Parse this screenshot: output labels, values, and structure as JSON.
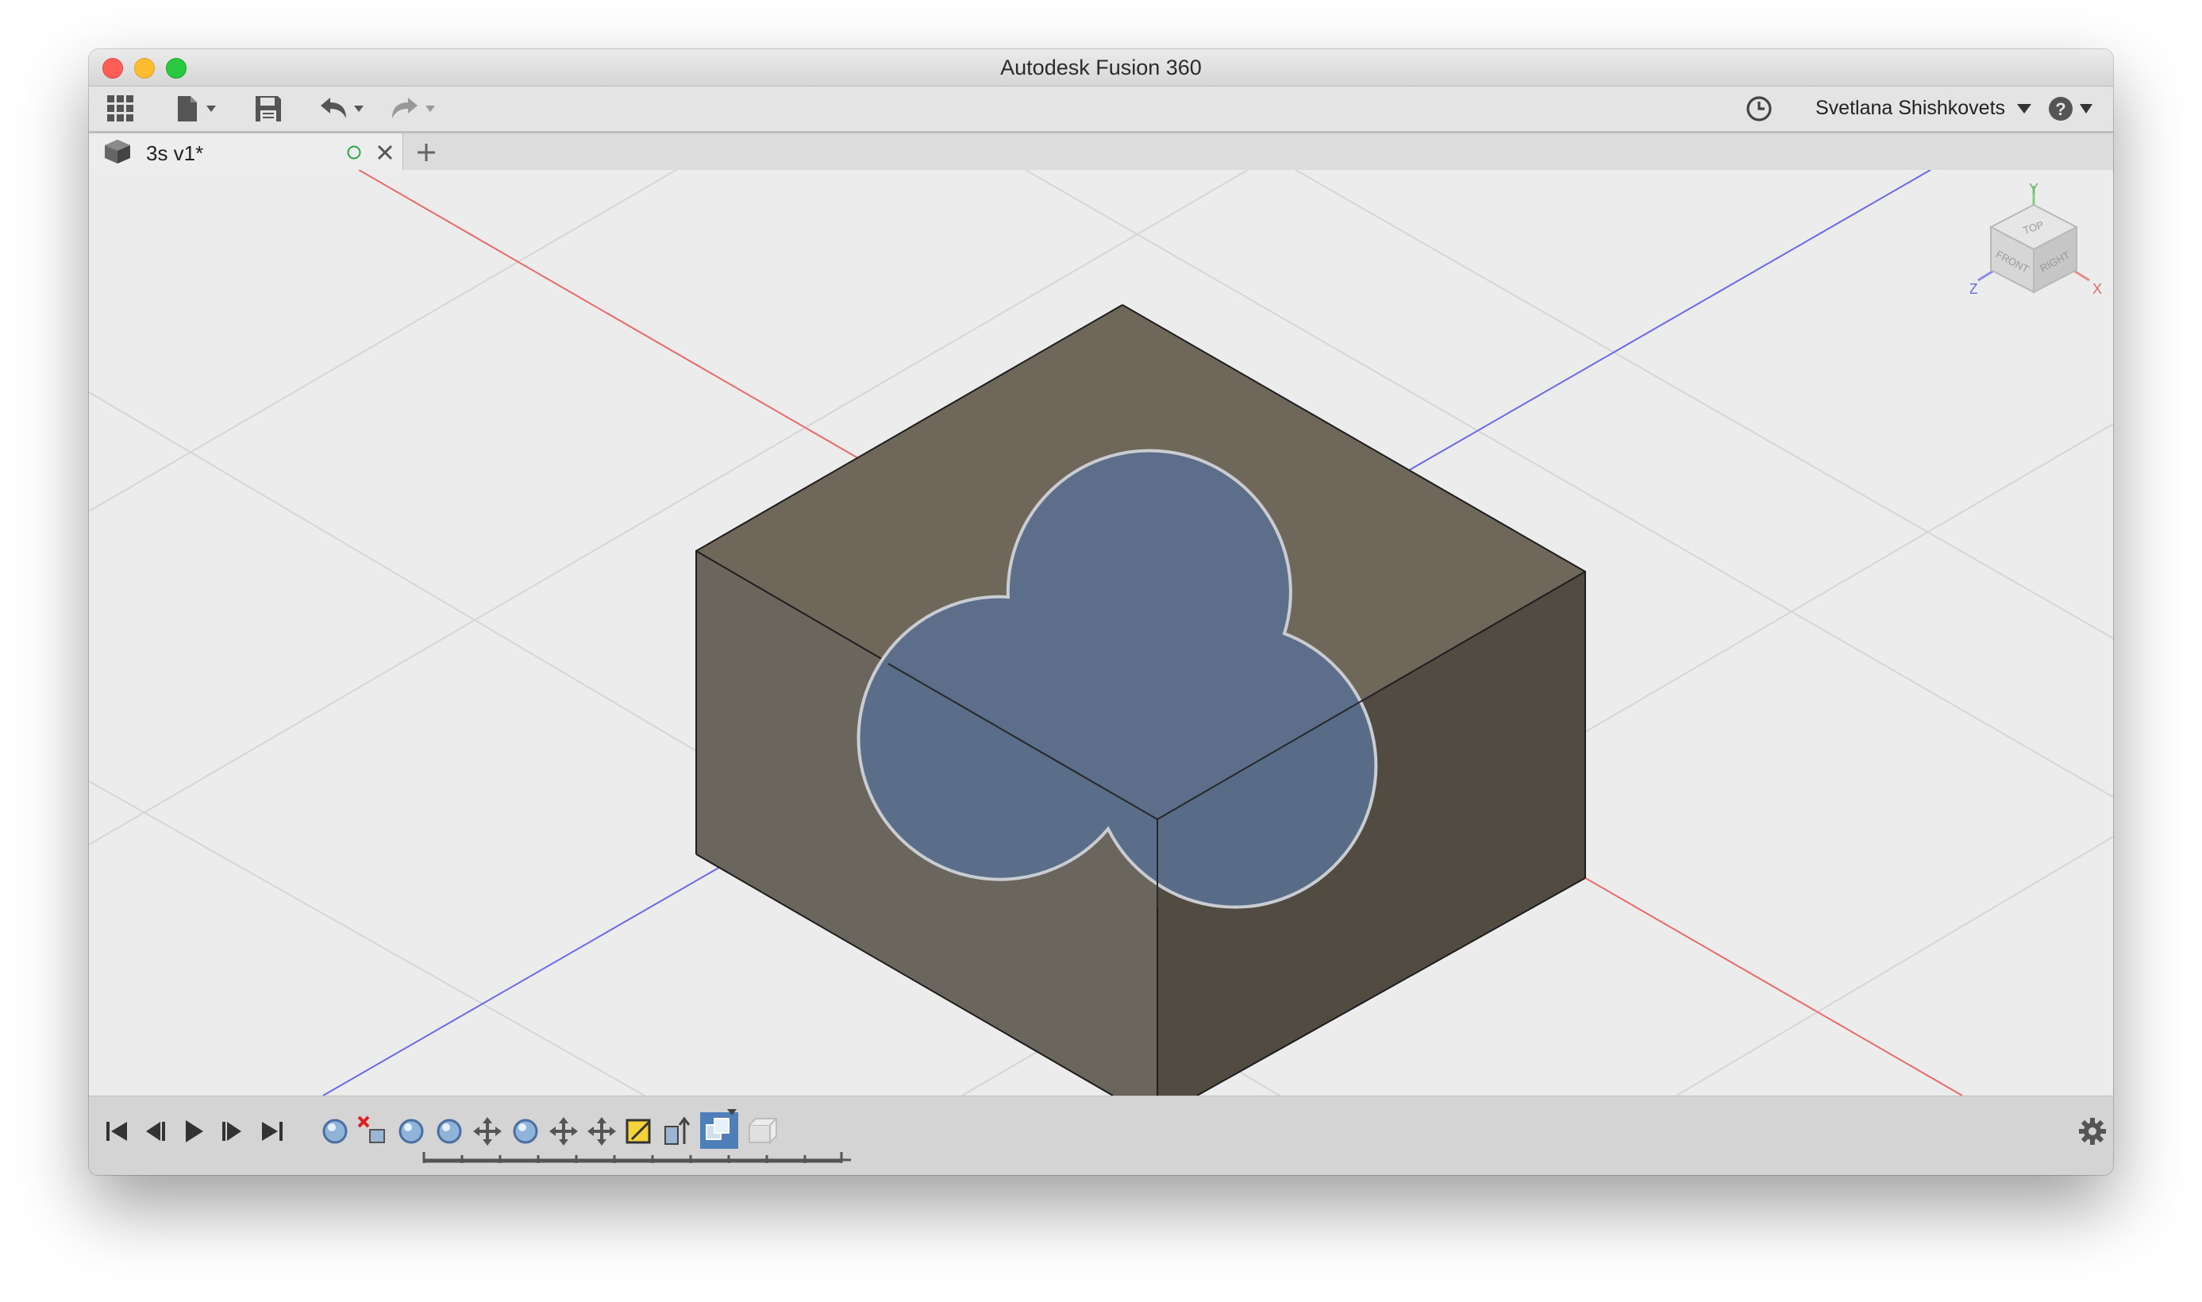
{
  "window": {
    "title": "Autodesk Fusion 360"
  },
  "toolbar": {
    "data_panel_icon": "grid-icon",
    "file_icon": "document-icon",
    "save_icon": "save-icon",
    "undo_icon": "undo-icon",
    "redo_icon": "redo-icon",
    "job_status_icon": "clock-icon",
    "user_name": "Svetlana Shishkovets",
    "help_icon": "help-icon"
  },
  "tabs": [
    {
      "label": "3s v1*",
      "icon": "component-icon",
      "status_icon": "status-circle-icon",
      "close_icon": "close-icon"
    }
  ],
  "new_tab_icon": "plus-icon",
  "viewcube": {
    "top": "TOP",
    "front": "FRONT",
    "right": "RIGHT",
    "axis_x": "X",
    "axis_y": "Y",
    "axis_z": "Z"
  },
  "colors": {
    "x_axis": "#e84a4a",
    "z_axis": "#5a5ae8",
    "sketch_fill": "#5a6f8d",
    "body_top": "#706858",
    "body_left": "#6b675d",
    "body_right": "#524c43"
  },
  "timeline": {
    "controls": [
      "skip-to-start-icon",
      "step-back-icon",
      "play-icon",
      "step-forward-icon",
      "skip-to-end-icon"
    ],
    "features": [
      "sketch-icon",
      "delete-body-icon",
      "sketch-icon",
      "sketch-icon",
      "move-icon",
      "sketch-icon",
      "move-icon",
      "move-icon",
      "sketch-edit-icon",
      "extrude-icon",
      "combine-icon",
      "body-icon"
    ],
    "settings_icon": "gear-icon"
  }
}
